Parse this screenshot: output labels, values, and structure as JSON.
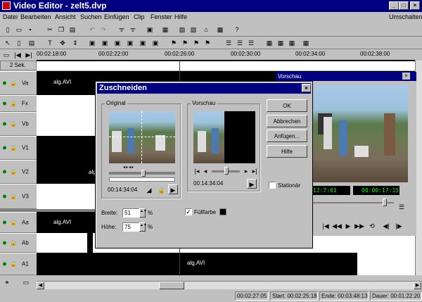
{
  "window": {
    "title": "Video Editor - zelt5.dvp",
    "right_label": "Umschalten"
  },
  "menu": [
    "Datei",
    "Bearbeiten",
    "Ansicht",
    "Suchen",
    "Einfügen",
    "Clip",
    "Fenster",
    "Hilfe"
  ],
  "ruler": {
    "scale": "2 Sek.",
    "times": [
      "00:02:18:00",
      "00:02:22:00",
      "00:02:26:00",
      "00:02:30:00",
      "00:02:34:00",
      "00:02:38:00"
    ]
  },
  "tracks": [
    {
      "name": "Va",
      "clip": "alg.AVI"
    },
    {
      "name": "Fx",
      "clip": ""
    },
    {
      "name": "Vb",
      "clip": ""
    },
    {
      "name": "V1",
      "clip": ""
    },
    {
      "name": "V2",
      "clip": "alg.AVI"
    },
    {
      "name": "V3",
      "clip": ""
    },
    {
      "name": "Aa",
      "clip": "alg.AVI"
    },
    {
      "name": "Ab",
      "clip": ""
    },
    {
      "name": "A1",
      "clip": "alg.AVI"
    }
  ],
  "preview": {
    "title": "Vorschau",
    "timecode_in": "00:00:17:15",
    "timecode_left": "12:7:01"
  },
  "dialog": {
    "title": "Zuschneiden",
    "original_label": "Original",
    "vorschau_label": "Vorschau",
    "original_time": "00:14:34:04",
    "vorschau_time": "00:14:34:04",
    "breite_label": "Breite:",
    "breite_value": "51",
    "hoehe_label": "Höhe:",
    "hoehe_value": "75",
    "percent": "%",
    "fuellfarbe_label": "Füllfarbe",
    "stationaer_label": "Stationär",
    "buttons": {
      "ok": "OK",
      "abbrechen": "Abbrechen",
      "anfuegen": "Anfügen...",
      "hilfe": "Hilfe"
    }
  },
  "status": {
    "pos": "00:02:27:05",
    "start": "Start: 00:02:25:18",
    "ende": "Ende: 00:03:48:13",
    "dauer": "Dauer: 00:01:22:20"
  },
  "colors": {
    "titlebar": "#000080",
    "timecode_green": "#00ff00"
  }
}
